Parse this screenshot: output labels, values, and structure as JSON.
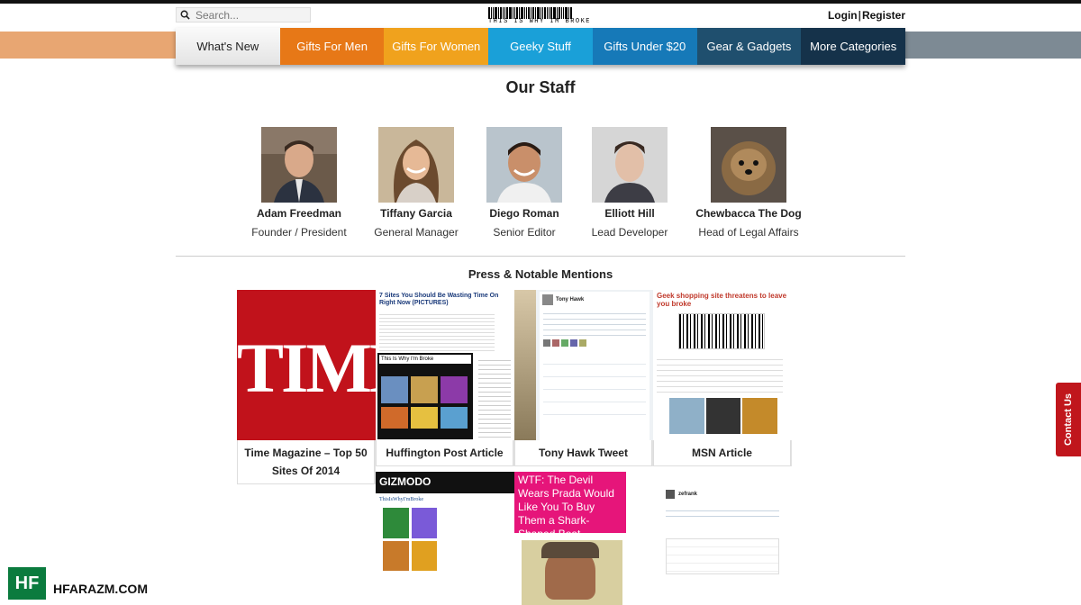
{
  "header": {
    "search_placeholder": "Search...",
    "logo_text": "THIS IS WHY IM BROKE",
    "login": "Login",
    "separator": "|",
    "register": "Register"
  },
  "nav": {
    "items": [
      {
        "label": "What's New",
        "color": "#eeeeee"
      },
      {
        "label": "Gifts For Men",
        "color": "#e77817"
      },
      {
        "label": "Gifts For Women",
        "color": "#f0a21d"
      },
      {
        "label": "Geeky Stuff",
        "color": "#1aa0d8"
      },
      {
        "label": "Gifts Under $20",
        "color": "#1679b8"
      },
      {
        "label": "Gear & Gadgets",
        "color": "#1f4f6e"
      },
      {
        "label": "More Categories",
        "color": "#15324a"
      }
    ]
  },
  "staff": {
    "title": "Our Staff",
    "members": [
      {
        "name": "Adam Freedman",
        "role": "Founder / President"
      },
      {
        "name": "Tiffany Garcia",
        "role": "General Manager"
      },
      {
        "name": "Diego Roman",
        "role": "Senior Editor"
      },
      {
        "name": "Elliott Hill",
        "role": "Lead Developer"
      },
      {
        "name": "Chewbacca The Dog",
        "role": "Head of Legal Affairs"
      }
    ]
  },
  "press": {
    "title": "Press & Notable Mentions",
    "items": [
      {
        "caption": "Time Magazine – Top 50 Sites Of 2014",
        "thumb_text": "TIME"
      },
      {
        "caption": "Huffington Post Article",
        "thumb_text": "7 Sites You Should Be Wasting Time On Right Now (PICTURES)",
        "sub_text": "This Is Why I'm Broke"
      },
      {
        "caption": "Tony Hawk Tweet",
        "thumb_text": "Tony Hawk"
      },
      {
        "caption": "MSN Article",
        "thumb_text": "Geek shopping site threatens to leave you broke"
      },
      {
        "caption": "",
        "thumb_text": "GIZMODO",
        "sub_text": "ThisIsWhyI'mBroke"
      },
      {
        "caption": "",
        "thumb_text": "WTF: The Devil Wears Prada Would Like You To Buy Them a Shark-Shaped Boat"
      },
      {
        "caption": "",
        "thumb_text": "zefrank"
      }
    ]
  },
  "contact": {
    "label": "Contact Us"
  },
  "watermark": {
    "badge": "HF",
    "text": "HFARAZM.COM"
  }
}
